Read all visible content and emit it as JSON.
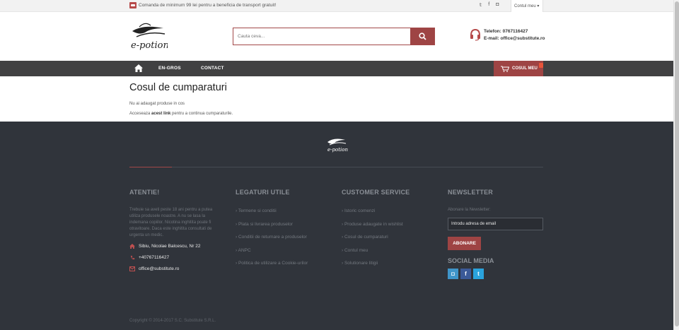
{
  "topbar": {
    "notice": "Comanda de minimum 99 lei pentru a beneficia de transport gratuit!",
    "social_twitter": "𝕥",
    "social_facebook": "f",
    "social_instagram": "◘",
    "account_label": "Contul meu ▾"
  },
  "header": {
    "search_placeholder": "Cauta ceva...",
    "phone_line": "Telefon: 0767116427",
    "email_line": "E-mail: office@substitute.ro"
  },
  "nav": {
    "items": [
      {
        "label": "EN-GROS"
      },
      {
        "label": "CONTACT"
      }
    ],
    "cart_label": "COSUL MEU"
  },
  "content": {
    "title": "Cosul de cumparaturi",
    "empty_message": "Nu ai adaugat produse in cos",
    "hint_prefix": "Acceseaza ",
    "hint_link": "acest link",
    "hint_suffix": " pentru a continua cumparaturile."
  },
  "footer": {
    "attention": {
      "title": "ATENTIE!",
      "text": "Trebuie sa aveti peste 18 ani pentru a putea utiliza produsele noastre. A nu se lasa la indemana copiilor. Nicotina inghitita poate fi otravitoare. Daca este inghitita consultati de urgenta un medic.",
      "address": "Sibiu, Nicolae Balcescu, Nr 22",
      "phone": "+40767116427",
      "email": "office@substitute.ro"
    },
    "useful": {
      "title": "LEGATURI UTILE",
      "links": [
        "› Termene si conditii",
        "› Plata si livrarea produselor",
        "› Conditii de returnare a produselor",
        "› ANPC",
        "› Politica de utilizare a Cookie-urilor"
      ]
    },
    "service": {
      "title": "CUSTOMER SERVICE",
      "links": [
        "› Istoric comenzi",
        "› Produse adaugate in wishlist",
        "› Cosul de cumparaturi",
        "› Contul meu",
        "› Solutionare litigii"
      ]
    },
    "newsletter": {
      "title": "NEWSLETTER",
      "label": "Abonare la Newsletter:",
      "input_value": "Introdu adresa de email",
      "button": "ABONARE"
    },
    "social": {
      "title": "SOCIAL MEDIA",
      "instagram": "◘",
      "facebook": "f",
      "twitter": "t"
    },
    "copyright": "Copyright © 2014-2017 S.C. Substitute S.R.L."
  },
  "colors": {
    "brand_red": "#9e4444",
    "nav_bg": "#414142",
    "footer_bg": "#30343b",
    "instagram": "#3f95c9",
    "facebook": "#3b5a98",
    "twitter": "#2aa3dd"
  }
}
